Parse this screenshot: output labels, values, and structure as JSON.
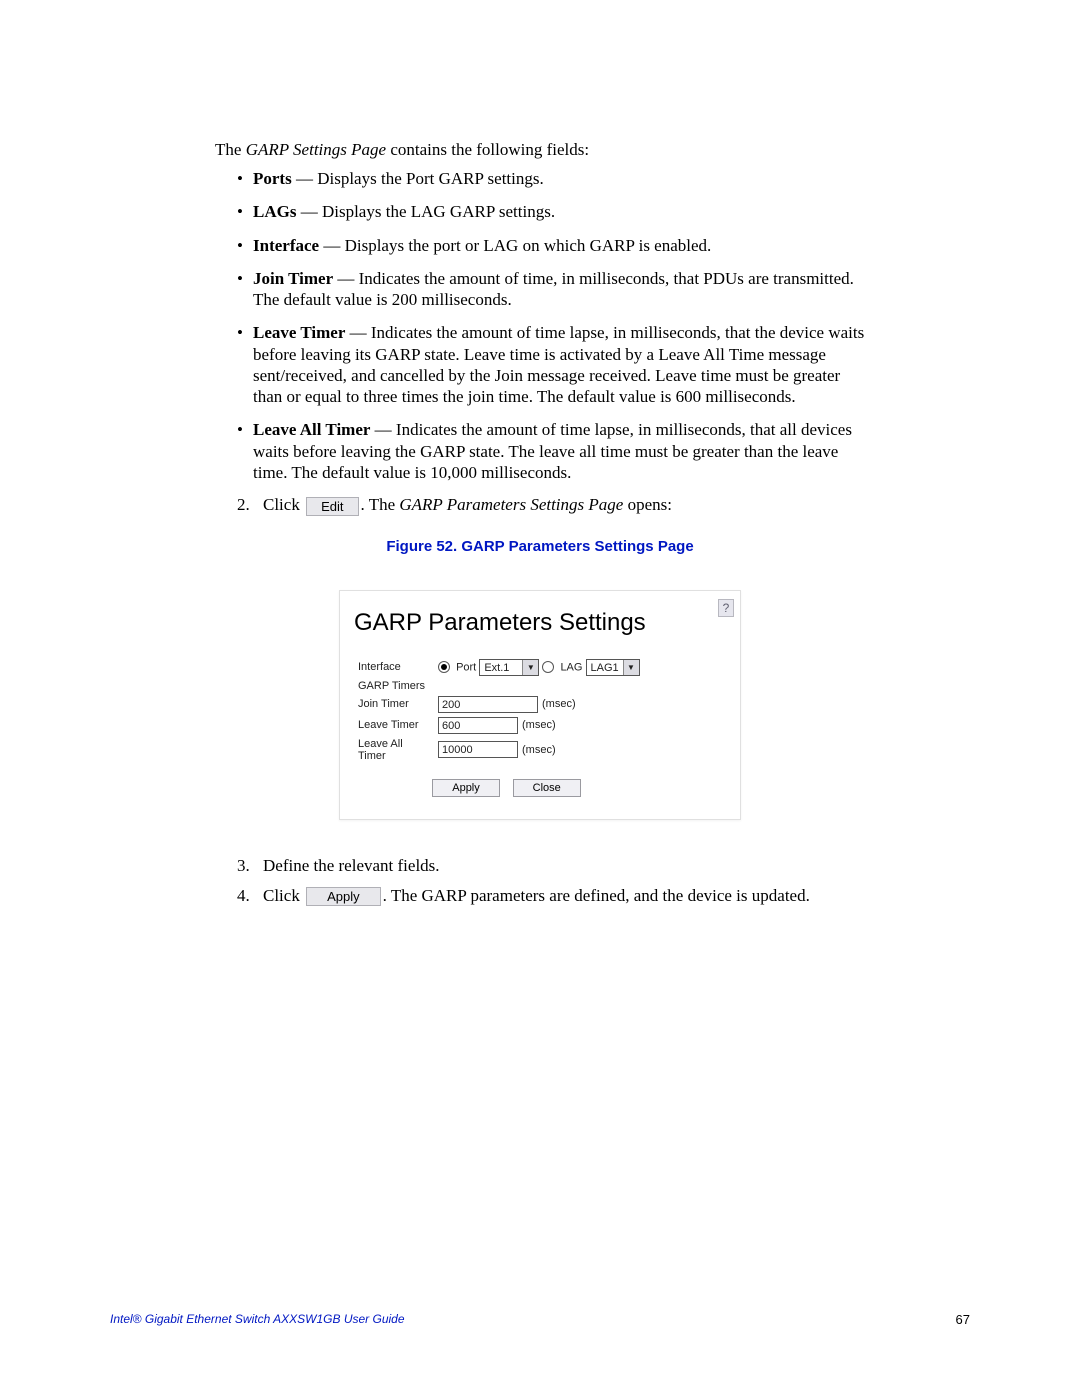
{
  "intro": {
    "pre": "The ",
    "page_name": "GARP Settings Page",
    "post": " contains the following fields:"
  },
  "fields": [
    {
      "name": "Ports",
      "desc": " — Displays the Port GARP settings."
    },
    {
      "name": "LAGs",
      "desc": " — Displays the LAG GARP settings."
    },
    {
      "name": "Interface",
      "desc": " — Displays the port or LAG on which GARP is enabled."
    },
    {
      "name": "Join Timer",
      "desc": " — Indicates the amount of time, in milliseconds, that PDUs are transmitted. The default value is 200 milliseconds."
    },
    {
      "name": "Leave Timer",
      "desc": " — Indicates the amount of time lapse, in milliseconds, that the device waits before leaving its GARP state. Leave time is activated by a Leave All Time message sent/received, and cancelled by the Join message received. Leave time must be greater than or equal to three times the join time. The default value is 600 milliseconds."
    },
    {
      "name": "Leave All Timer",
      "desc": " — Indicates the amount of time lapse, in milliseconds, that all devices waits before leaving the GARP state. The leave all time must be greater than the leave time. The default value is 10,000 milliseconds."
    }
  ],
  "step2": {
    "num": "2.",
    "click": "Click ",
    "btn": "Edit",
    "mid": ". The ",
    "page": "GARP Parameters Settings Page",
    "end": " opens:"
  },
  "fig_caption": "Figure 52. GARP Parameters Settings Page",
  "dialog": {
    "title": "GARP Parameters Settings",
    "help": "?",
    "labels": {
      "interface": "Interface",
      "garp_timers": "GARP Timers",
      "join": "Join Timer",
      "leave": "Leave Timer",
      "leave_all": "Leave All Timer"
    },
    "radio_port": "Port",
    "radio_lag": "LAG",
    "port_val": "Ext.1",
    "lag_val": "LAG1",
    "join_val": "200",
    "leave_val": "600",
    "leave_all_val": "10000",
    "unit": "(msec)",
    "apply": "Apply",
    "close": "Close"
  },
  "step3": {
    "num": "3.",
    "text": "Define the relevant fields."
  },
  "step4": {
    "num": "4.",
    "click": "Click ",
    "btn": "Apply",
    "end": ". The GARP parameters are defined, and the device is updated."
  },
  "footer": {
    "title": "Intel® Gigabit Ethernet Switch AXXSW1GB User Guide",
    "page": "67"
  }
}
